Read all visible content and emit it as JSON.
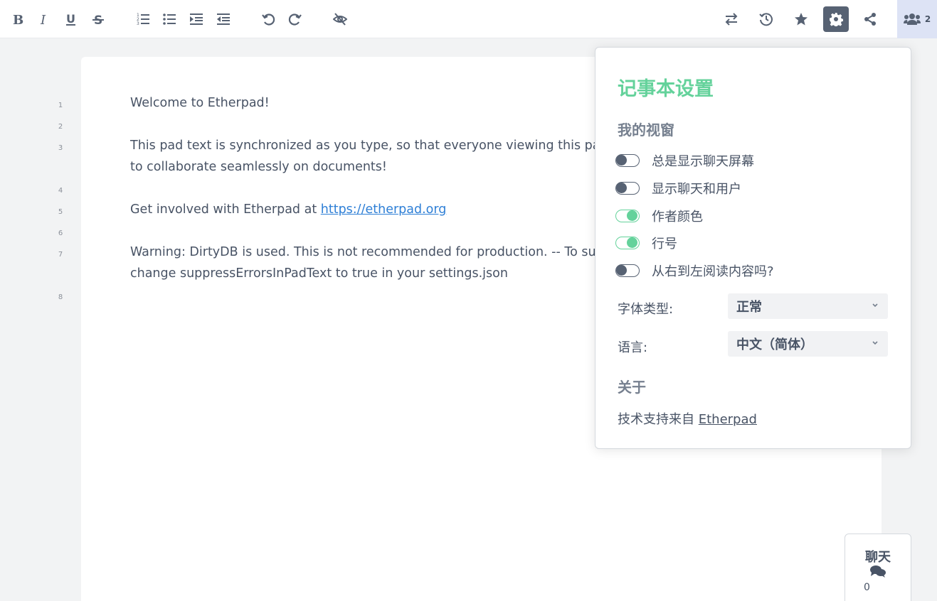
{
  "toolbar": {
    "left_icons": [
      "bold-icon",
      "italic-icon",
      "underline-icon",
      "strikethrough-icon",
      "ordered-list-icon",
      "unordered-list-icon",
      "indent-icon",
      "outdent-icon",
      "undo-icon",
      "redo-icon",
      "clear-authorship-icon"
    ],
    "right_icons": [
      "import-export-icon",
      "timeslider-icon",
      "saved-revision-icon",
      "settings-icon",
      "share-icon"
    ],
    "users_count": "2"
  },
  "editor": {
    "line_numbers": [
      "1",
      "2",
      "3",
      "4",
      "5",
      "6",
      "7",
      "8"
    ],
    "lines": {
      "l1": "Welcome to Etherpad!",
      "l3a": "This pad text is synchronized as you type, so that everyone viewing this pa",
      "l3b": "to collaborate seamlessly on documents!",
      "l5_prefix": "Get involved with Etherpad at ",
      "l5_link": "https://etherpad.org",
      "l7a": "Warning: DirtyDB is used. This is not recommended for production. -- To sup",
      "l7b": "change suppressErrorsInPadText to true in your settings.json"
    }
  },
  "settings": {
    "title": "记事本设置",
    "my_view": "我的视窗",
    "options": [
      {
        "label": "总是显示聊天屏幕",
        "on": false
      },
      {
        "label": "显示聊天和用户",
        "on": false
      },
      {
        "label": "作者颜色",
        "on": true
      },
      {
        "label": "行号",
        "on": true
      },
      {
        "label": "从右到左阅读内容吗?",
        "on": false
      }
    ],
    "font_label": "字体类型:",
    "font_value": "正常",
    "lang_label": "语言:",
    "lang_value": "中文（简体）",
    "about_heading": "关于",
    "powered_by": "技术支持来自 ",
    "powered_link": "Etherpad"
  },
  "chat": {
    "label": "聊天",
    "count": "0"
  },
  "colors": {
    "accent": "#64d29b",
    "text": "#485365",
    "link": "#2e7fd6"
  }
}
